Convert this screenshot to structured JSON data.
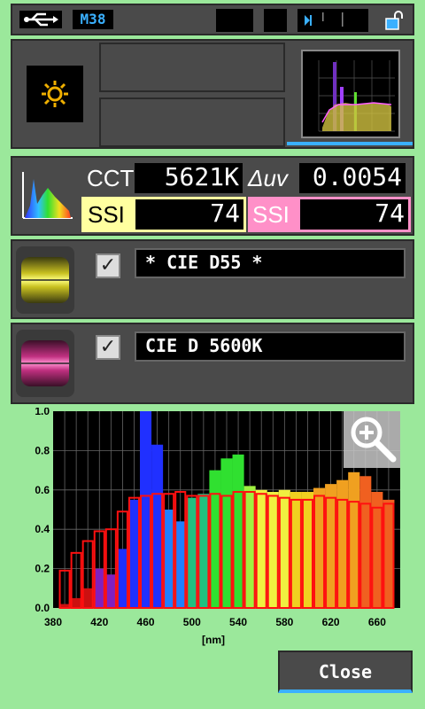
{
  "top_bar": {
    "memory_label": "M38"
  },
  "measurement": {
    "cct_label": "CCT",
    "cct_value": "5621K",
    "duv_label": "Δuv",
    "duv_value": "0.0054",
    "ssi1_label": "SSI",
    "ssi1_value": "74",
    "ssi2_label": "SSI",
    "ssi2_value": "74"
  },
  "references": [
    {
      "name": "* CIE D55 *",
      "checked": true,
      "check_glyph": "✓"
    },
    {
      "name": "CIE D 5600K",
      "checked": true,
      "check_glyph": "✓"
    }
  ],
  "chart_data": {
    "type": "bar",
    "x_ticks": [
      "380",
      "420",
      "460",
      "500",
      "540",
      "580",
      "620",
      "660"
    ],
    "y_ticks": [
      "0.0",
      "0.2",
      "0.4",
      "0.6",
      "0.8",
      "1.0"
    ],
    "xlabel": "[nm]",
    "ylim": [
      0,
      1.0
    ],
    "xlim": [
      380,
      680
    ],
    "series": [
      {
        "x": [
          390,
          400,
          410,
          420,
          430,
          440,
          450,
          460,
          470,
          480,
          490,
          500,
          510,
          520,
          530,
          540,
          550,
          560,
          570,
          580,
          590,
          600,
          610,
          620,
          630,
          640,
          650,
          660,
          670
        ],
        "values": [
          0.02,
          0.05,
          0.1,
          0.2,
          0.17,
          0.3,
          0.55,
          1.0,
          0.83,
          0.5,
          0.44,
          0.56,
          0.58,
          0.7,
          0.76,
          0.78,
          0.62,
          0.6,
          0.59,
          0.6,
          0.59,
          0.59,
          0.61,
          0.63,
          0.65,
          0.69,
          0.67,
          0.59,
          0.55
        ]
      },
      {
        "x": [
          390,
          400,
          410,
          420,
          430,
          440,
          450,
          460,
          470,
          480,
          490,
          500,
          510,
          520,
          530,
          540,
          550,
          560,
          570,
          580,
          590,
          600,
          610,
          620,
          630,
          640,
          650,
          660,
          670
        ],
        "values": [
          0.19,
          0.28,
          0.34,
          0.39,
          0.4,
          0.49,
          0.56,
          0.57,
          0.58,
          0.58,
          0.59,
          0.57,
          0.57,
          0.58,
          0.57,
          0.59,
          0.59,
          0.58,
          0.57,
          0.56,
          0.55,
          0.55,
          0.57,
          0.56,
          0.55,
          0.54,
          0.53,
          0.51,
          0.53
        ]
      }
    ]
  },
  "close_button": {
    "label": "Close"
  }
}
